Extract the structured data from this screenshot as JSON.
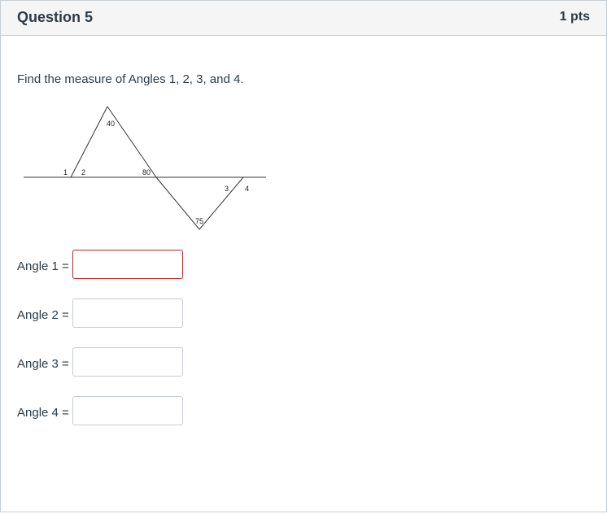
{
  "question": {
    "title": "Question 5",
    "points": "1 pts",
    "prompt": "Find the measure of Angles 1, 2, 3, and 4."
  },
  "diagram": {
    "labels": {
      "top_angle": "40",
      "angle_1": "1",
      "angle_2": "2",
      "angle_80": "80",
      "angle_3": "3",
      "angle_4": "4",
      "bottom_angle": "75"
    }
  },
  "answers": [
    {
      "label": "Angle 1 =",
      "value": "",
      "invalid": true
    },
    {
      "label": "Angle 2 =",
      "value": "",
      "invalid": false
    },
    {
      "label": "Angle 3 =",
      "value": "",
      "invalid": false
    },
    {
      "label": "Angle 4 =",
      "value": "",
      "invalid": false
    }
  ],
  "colors": {
    "header_bg": "#f5f5f5",
    "border": "#c7cdd1",
    "invalid_border": "#b0292d",
    "text": "#2d3b45"
  }
}
